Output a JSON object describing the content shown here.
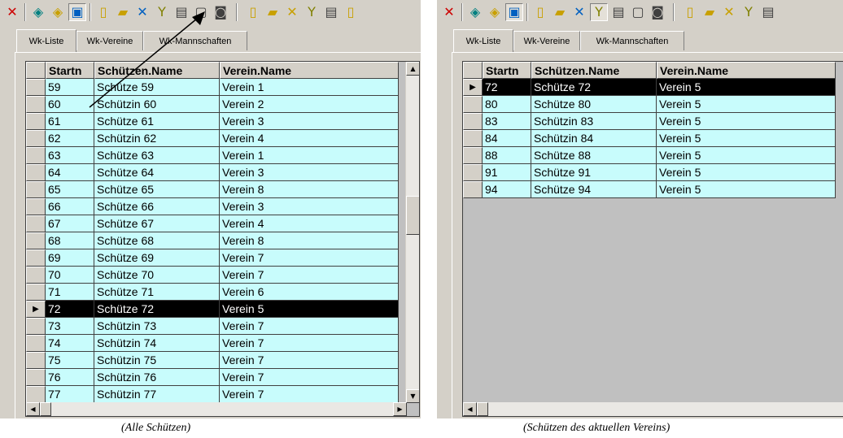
{
  "left": {
    "toolbar_glyphs": [
      "✕",
      "◈",
      "◈",
      "▣",
      "🗋",
      "📂",
      "✕",
      "Y",
      "🖶",
      "🗋",
      "📷",
      "🗋",
      "📂",
      "✕",
      "Y",
      "🖶",
      "▯"
    ],
    "tabs": [
      "Wk-Liste",
      "Wk-Vereine",
      "Wk-Mannschaften"
    ],
    "columns": [
      "Startn",
      "Schützen.Name",
      "Verein.Name"
    ],
    "rows": [
      [
        "59",
        "Schütze 59",
        "Verein 1"
      ],
      [
        "60",
        "Schützin 60",
        "Verein 2"
      ],
      [
        "61",
        "Schütze 61",
        "Verein 3"
      ],
      [
        "62",
        "Schützin 62",
        "Verein 4"
      ],
      [
        "63",
        "Schütze 63",
        "Verein 1"
      ],
      [
        "64",
        "Schütze 64",
        "Verein 3"
      ],
      [
        "65",
        "Schütze 65",
        "Verein 8"
      ],
      [
        "66",
        "Schütze 66",
        "Verein 3"
      ],
      [
        "67",
        "Schütze 67",
        "Verein 4"
      ],
      [
        "68",
        "Schütze 68",
        "Verein 8"
      ],
      [
        "69",
        "Schütze 69",
        "Verein 7"
      ],
      [
        "70",
        "Schütze 70",
        "Verein 7"
      ],
      [
        "71",
        "Schütze 71",
        "Verein 6"
      ],
      [
        "72",
        "Schütze 72",
        "Verein 5"
      ],
      [
        "73",
        "Schützin 73",
        "Verein 7"
      ],
      [
        "74",
        "Schützin 74",
        "Verein 7"
      ],
      [
        "75",
        "Schützin 75",
        "Verein 7"
      ],
      [
        "76",
        "Schützin 76",
        "Verein 7"
      ],
      [
        "77",
        "Schützin 77",
        "Verein 7"
      ]
    ],
    "selected_startn": "72",
    "caption": "(Alle Schützen)"
  },
  "right": {
    "tabs": [
      "Wk-Liste",
      "Wk-Vereine",
      "Wk-Mannschaften"
    ],
    "columns": [
      "Startn",
      "Schützen.Name",
      "Verein.Name"
    ],
    "rows": [
      [
        "72",
        "Schütze 72",
        "Verein 5"
      ],
      [
        "80",
        "Schütze 80",
        "Verein 5"
      ],
      [
        "83",
        "Schützin 83",
        "Verein 5"
      ],
      [
        "84",
        "Schützin 84",
        "Verein 5"
      ],
      [
        "88",
        "Schütze 88",
        "Verein 5"
      ],
      [
        "91",
        "Schütze 91",
        "Verein 5"
      ],
      [
        "94",
        "Schütze 94",
        "Verein 5"
      ]
    ],
    "selected_startn": "72",
    "caption": "(Schützen des aktuellen Vereins)"
  },
  "colors": {
    "row_bg": "#c8fcfc",
    "selected_bg": "#000000",
    "chrome": "#d4d0c8",
    "close_red": "#cc0000"
  }
}
